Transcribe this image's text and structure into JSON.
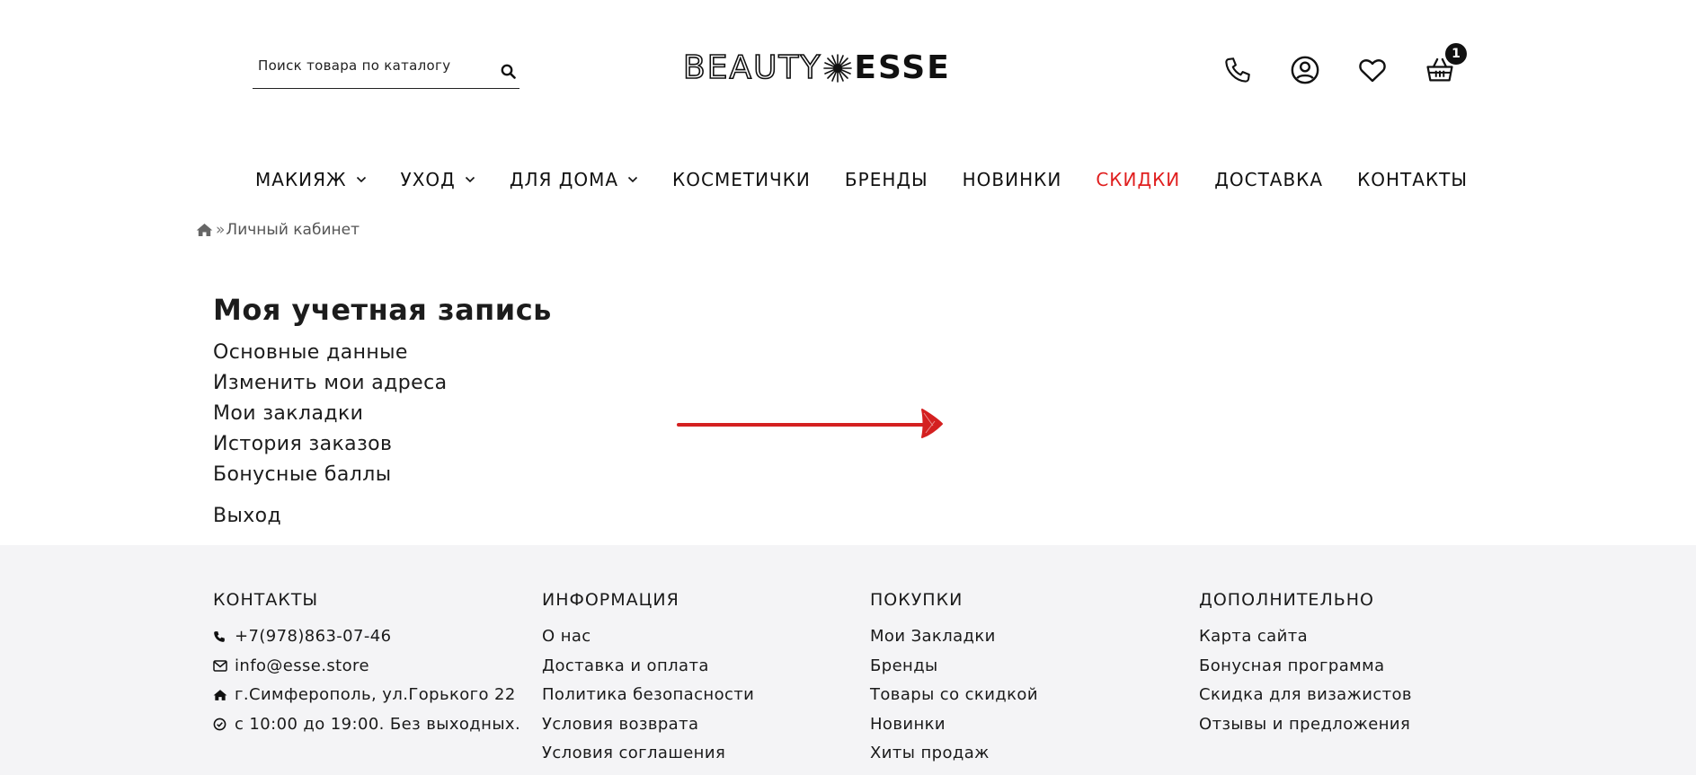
{
  "header": {
    "search_placeholder": "Поиск товара по каталогу",
    "logo_left": "BEAUTY",
    "logo_right": "ESSE",
    "cart_count": "1",
    "icons": [
      "phone-icon",
      "user-icon",
      "heart-icon",
      "basket-icon"
    ]
  },
  "nav": {
    "items": [
      {
        "label": "МАКИЯЖ",
        "dropdown": true
      },
      {
        "label": "УХОД",
        "dropdown": true
      },
      {
        "label": "ДЛЯ ДОМА",
        "dropdown": true
      },
      {
        "label": "КОСМЕТИЧКИ",
        "dropdown": false
      },
      {
        "label": "БРЕНДЫ",
        "dropdown": false
      },
      {
        "label": "НОВИНКИ",
        "dropdown": false
      },
      {
        "label": "СКИДКИ",
        "dropdown": false,
        "highlight": "#e01f1f"
      },
      {
        "label": "ДОСТАВКА",
        "dropdown": false
      },
      {
        "label": "КОНТАКТЫ",
        "dropdown": false
      }
    ]
  },
  "breadcrumb": {
    "separator": "»",
    "current": "Личный кабинет"
  },
  "account": {
    "title": "Моя учетная запись",
    "links": [
      "Основные данные",
      "Изменить мои адреса",
      "Мои закладки",
      "История заказов",
      "Бонусные баллы"
    ],
    "logout": "Выход"
  },
  "annotation": {
    "arrow_color": "#d42020"
  },
  "footer": {
    "columns": [
      {
        "title": "КОНТАКТЫ",
        "contacts": [
          {
            "icon": "phone-icon",
            "text": "+7(978)863-07-46"
          },
          {
            "icon": "envelope-icon",
            "text": "info@esse.store"
          },
          {
            "icon": "home-icon",
            "text": "г.Симферополь, ул.Горького 22"
          },
          {
            "icon": "clock-check-icon",
            "text": "с 10:00 до 19:00. Без выходных."
          }
        ]
      },
      {
        "title": "ИНФОРМАЦИЯ",
        "links": [
          "О нас",
          "Доставка и оплата",
          "Политика безопасности",
          "Условия возврата",
          "Условия соглашения"
        ]
      },
      {
        "title": "ПОКУПКИ",
        "links": [
          "Мои Закладки",
          "Бренды",
          "Товары со скидкой",
          "Новинки",
          "Хиты продаж"
        ]
      },
      {
        "title": "ДОПОЛНИТЕЛЬНО",
        "links": [
          "Карта сайта",
          "Бонусная программа",
          "Скидка для визажистов",
          "Отзывы и предложения"
        ]
      }
    ]
  }
}
